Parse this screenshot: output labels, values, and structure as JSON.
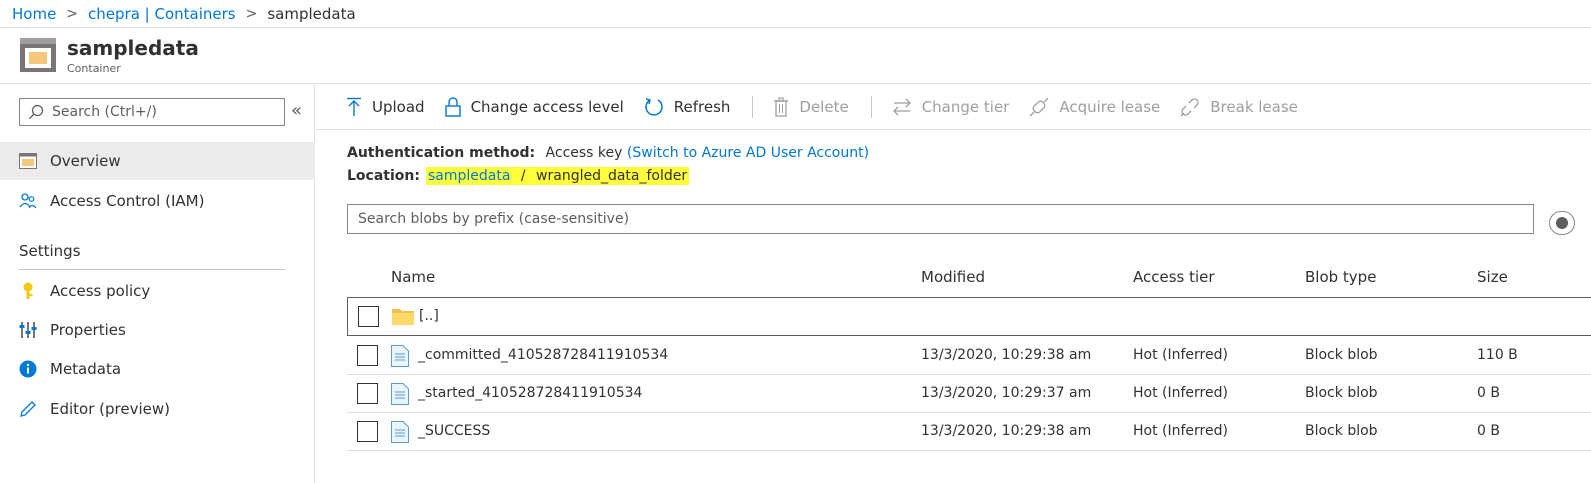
{
  "breadcrumb": {
    "home": "Home",
    "parent": "chepra | Containers",
    "current": "sampledata"
  },
  "header": {
    "title": "sampledata",
    "subtitle": "Container"
  },
  "sidebar": {
    "search_placeholder": "Search (Ctrl+/)",
    "collapse_glyph": "«",
    "items": [
      {
        "label": "Overview",
        "icon": "overview-icon"
      },
      {
        "label": "Access Control (IAM)",
        "icon": "people-icon"
      }
    ],
    "settings_title": "Settings",
    "settings_items": [
      {
        "label": "Access policy",
        "icon": "key-icon"
      },
      {
        "label": "Properties",
        "icon": "properties-icon"
      },
      {
        "label": "Metadata",
        "icon": "info-icon"
      },
      {
        "label": "Editor (preview)",
        "icon": "pencil-icon"
      }
    ]
  },
  "toolbar": {
    "upload": "Upload",
    "change_access": "Change access level",
    "refresh": "Refresh",
    "delete": "Delete",
    "change_tier": "Change tier",
    "acquire_lease": "Acquire lease",
    "break_lease": "Break lease"
  },
  "auth": {
    "label": "Authentication method:",
    "value": "Access key",
    "switch_link": "(Switch to Azure AD User Account)"
  },
  "location": {
    "label": "Location:",
    "container": "sampledata",
    "separator": "/",
    "folder": "wrangled_data_folder"
  },
  "blob_search": {
    "placeholder": "Search blobs by prefix (case-sensitive)"
  },
  "table": {
    "headers": {
      "name": "Name",
      "modified": "Modified",
      "tier": "Access tier",
      "type": "Blob type",
      "size": "Size"
    },
    "parent_row": "[..]",
    "rows": [
      {
        "name": "_committed_410528728411910534",
        "modified": "13/3/2020, 10:29:38 am",
        "tier": "Hot (Inferred)",
        "type": "Block blob",
        "size": "110 B"
      },
      {
        "name": "_started_410528728411910534",
        "modified": "13/3/2020, 10:29:37 am",
        "tier": "Hot (Inferred)",
        "type": "Block blob",
        "size": "0 B"
      },
      {
        "name": "_SUCCESS",
        "modified": "13/3/2020, 10:29:38 am",
        "tier": "Hot (Inferred)",
        "type": "Block blob",
        "size": "0 B"
      }
    ]
  },
  "colors": {
    "accent": "#0078d4",
    "highlight": "#ffff3b",
    "active_bg": "#edebe9"
  }
}
